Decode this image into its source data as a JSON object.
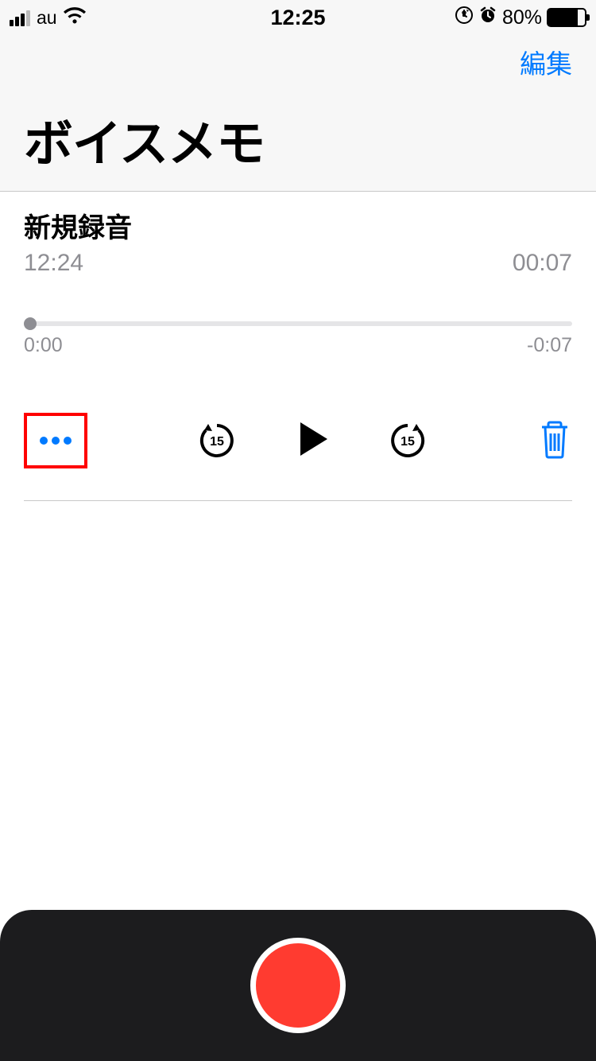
{
  "status": {
    "carrier": "au",
    "time": "12:25",
    "battery_pct": "80%"
  },
  "header": {
    "edit": "編集",
    "title": "ボイスメモ"
  },
  "recording": {
    "name": "新規録音",
    "time_recorded": "12:24",
    "duration": "00:07",
    "elapsed": "0:00",
    "remaining": "-0:07",
    "skip_seconds": "15"
  }
}
